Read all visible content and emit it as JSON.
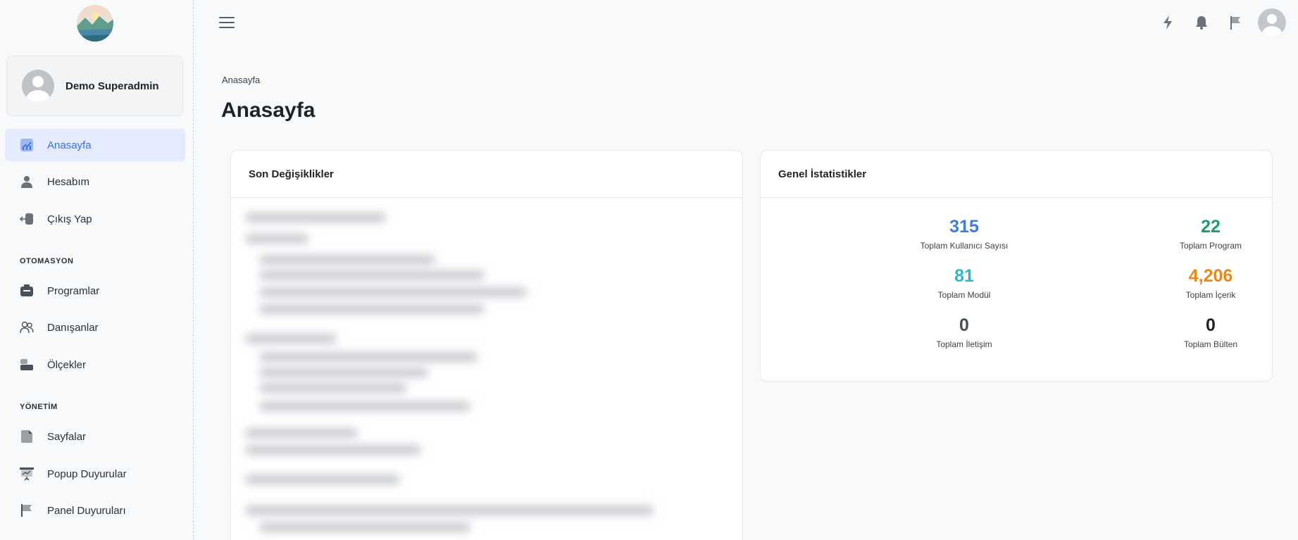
{
  "sidebar": {
    "user_name": "Demo Superadmin",
    "nav_main": [
      {
        "label": "Anasayfa",
        "icon": "chart-icon",
        "active": true
      },
      {
        "label": "Hesabım",
        "icon": "user-icon"
      },
      {
        "label": "Çıkış Yap",
        "icon": "logout-icon"
      }
    ],
    "section_automation": "OTOMASYON",
    "nav_automation": [
      {
        "label": "Programlar",
        "icon": "folder-icon"
      },
      {
        "label": "Danışanlar",
        "icon": "users-icon"
      },
      {
        "label": "Ölçekler",
        "icon": "scale-icon"
      }
    ],
    "section_management": "YÖNETİM",
    "nav_management": [
      {
        "label": "Sayfalar",
        "icon": "page-icon"
      },
      {
        "label": "Popup Duyurular",
        "icon": "presentation-icon"
      },
      {
        "label": "Panel Duyuruları",
        "icon": "flag-icon"
      }
    ]
  },
  "topbar": {
    "icons": [
      "bolt-icon",
      "bell-icon",
      "flag-icon",
      "avatar"
    ]
  },
  "breadcrumb": "Anasayfa",
  "page_title": "Anasayfa",
  "recent_changes": {
    "title": "Son Değişiklikler"
  },
  "general_stats": {
    "title": "Genel İstatistikler",
    "stats": [
      {
        "value": "315",
        "label": "Toplam Kullanıcı Sayısı",
        "color": "#3b7ddd"
      },
      {
        "value": "22",
        "label": "Toplam Program",
        "color": "#1f9d6b"
      },
      {
        "value": "81",
        "label": "Toplam Modül",
        "color": "#2bb9c9"
      },
      {
        "value": "4,206",
        "label": "Toplam İçerik",
        "color": "#e88a1a"
      },
      {
        "value": "0",
        "label": "Toplam İletişim",
        "color": "#4a5058"
      },
      {
        "value": "0",
        "label": "Toplam Bülten",
        "color": "#1f2328"
      }
    ]
  },
  "colors": {
    "accent": "#3a6fe8",
    "active_bg": "#e3ebfc"
  }
}
